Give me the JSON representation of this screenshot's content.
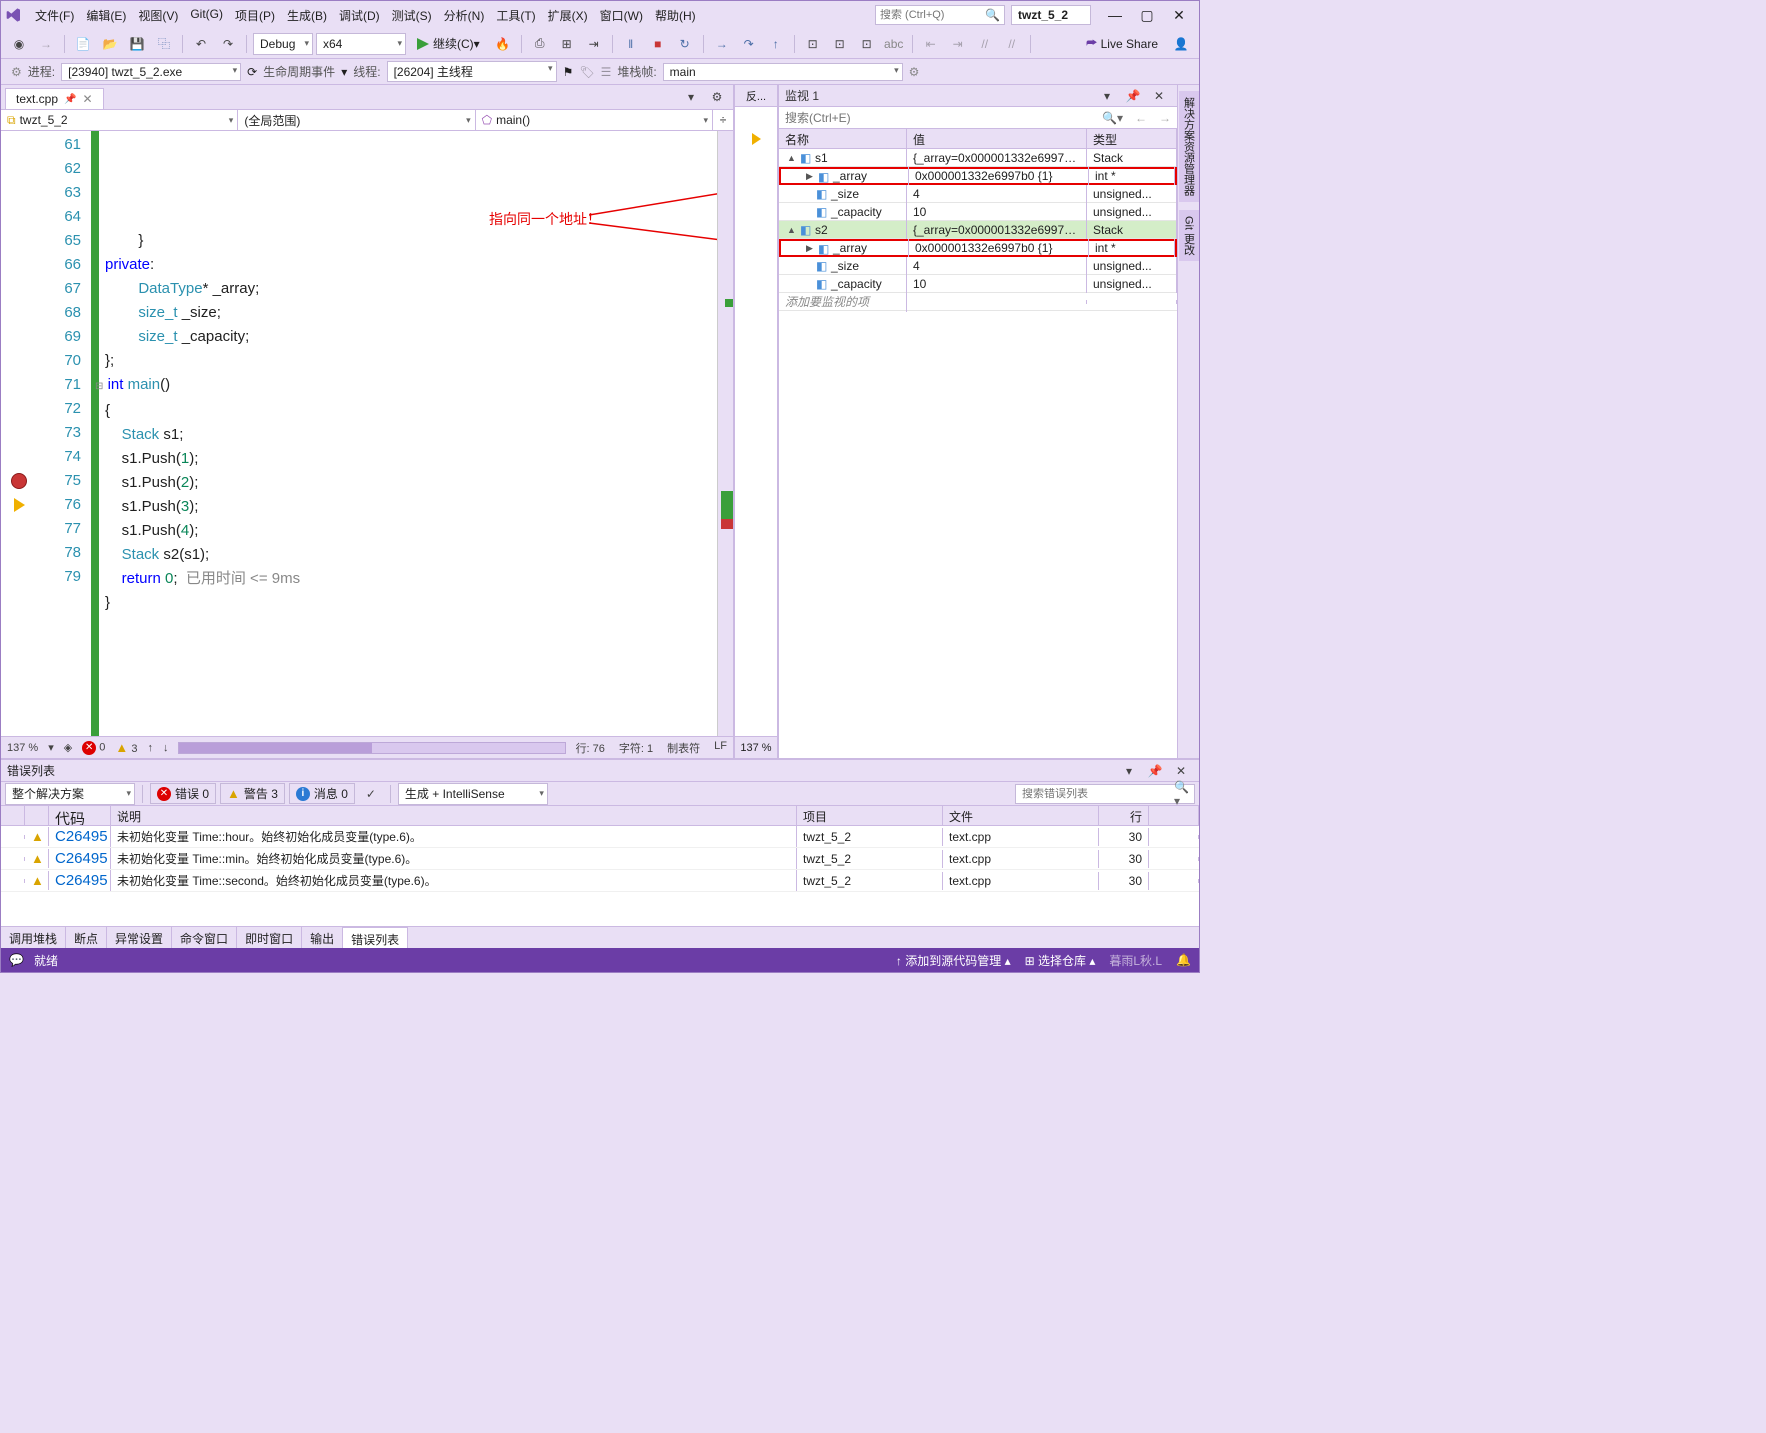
{
  "title": {
    "solution_name": "twzt_5_2",
    "search_placeholder": "搜索 (Ctrl+Q)"
  },
  "menubar": [
    "文件(F)",
    "编辑(E)",
    "视图(V)",
    "Git(G)",
    "项目(P)",
    "生成(B)",
    "调试(D)",
    "测试(S)",
    "分析(N)",
    "工具(T)",
    "扩展(X)",
    "窗口(W)",
    "帮助(H)"
  ],
  "toolbar": {
    "config": "Debug",
    "platform": "x64",
    "continue": "继续(C)",
    "liveshare": "Live Share"
  },
  "debugbar": {
    "process_lbl": "进程:",
    "process": "[23940] twzt_5_2.exe",
    "lifecycle": "生命周期事件",
    "thread_lbl": "线程:",
    "thread": "[26204] 主线程",
    "stackframe_lbl": "堆栈帧:",
    "stackframe": "main"
  },
  "editor": {
    "tab": "text.cpp",
    "nav1": "twzt_5_2",
    "nav2": "(全局范围)",
    "nav3": "main()",
    "annotation": "指向同一个地址！",
    "elapsed": "已用时间 <= 9ms",
    "zoom": "137 %",
    "err_count": "0",
    "warn_count": "3",
    "status_line": "行: 76",
    "status_col": "字符: 1",
    "status_tab": "制表符",
    "status_end": "LF",
    "mini_zoom": "137 %"
  },
  "code_lines": [
    {
      "n": 61,
      "html": "        }"
    },
    {
      "n": 62,
      "html": "<span class='kw'>private</span>:"
    },
    {
      "n": 63,
      "html": "        <span class='type'>DataType</span>* _array;"
    },
    {
      "n": 64,
      "html": "        <span class='type'>size_t</span> _size;"
    },
    {
      "n": 65,
      "html": "        <span class='type'>size_t</span> _capacity;"
    },
    {
      "n": 66,
      "html": "};"
    },
    {
      "n": 67,
      "html": ""
    },
    {
      "n": 68,
      "html": "<span class='kw'>int</span> <span class='type'>main</span>()"
    },
    {
      "n": 69,
      "html": "{"
    },
    {
      "n": 70,
      "html": "    <span class='type'>Stack</span> s1;"
    },
    {
      "n": 71,
      "html": "    s1.Push(<span class='num'>1</span>);"
    },
    {
      "n": 72,
      "html": "    s1.Push(<span class='num'>2</span>);"
    },
    {
      "n": 73,
      "html": "    s1.Push(<span class='num'>3</span>);"
    },
    {
      "n": 74,
      "html": "    s1.Push(<span class='num'>4</span>);"
    },
    {
      "n": 75,
      "html": "    <span class='type'>Stack</span> s2(s1);"
    },
    {
      "n": 76,
      "html": "    <span class='kw'>return</span> <span class='num'>0</span>;  <span class='cm'>已用时间 &lt;= 9ms</span>"
    },
    {
      "n": 77,
      "html": "}"
    },
    {
      "n": 78,
      "html": ""
    },
    {
      "n": 79,
      "html": ""
    }
  ],
  "watch": {
    "title": "监视 1",
    "search_placeholder": "搜索(Ctrl+E)",
    "headers": {
      "name": "名称",
      "value": "值",
      "type": "类型"
    },
    "rows": [
      {
        "depth": 0,
        "exp": "▲",
        "name": "s1",
        "value": "{_array=0x000001332e6997b0 {...",
        "type": "Stack",
        "sel": false
      },
      {
        "depth": 1,
        "exp": "▶",
        "name": "_array",
        "value": "0x000001332e6997b0 {1}",
        "type": "int *",
        "sel": false,
        "redbox": true
      },
      {
        "depth": 1,
        "exp": "",
        "name": "_size",
        "value": "4",
        "type": "unsigned...",
        "sel": false
      },
      {
        "depth": 1,
        "exp": "",
        "name": "_capacity",
        "value": "10",
        "type": "unsigned...",
        "sel": false
      },
      {
        "depth": 0,
        "exp": "▲",
        "name": "s2",
        "value": "{_array=0x000001332e6997b0 {...",
        "type": "Stack",
        "sel": true
      },
      {
        "depth": 1,
        "exp": "▶",
        "name": "_array",
        "value": "0x000001332e6997b0 {1}",
        "type": "int *",
        "sel": false,
        "redbox": true
      },
      {
        "depth": 1,
        "exp": "",
        "name": "_size",
        "value": "4",
        "type": "unsigned...",
        "sel": false
      },
      {
        "depth": 1,
        "exp": "",
        "name": "_capacity",
        "value": "10",
        "type": "unsigned...",
        "sel": false
      }
    ],
    "add_hint": "添加要监视的项"
  },
  "errors": {
    "title": "错误列表",
    "scope": "整个解决方案",
    "err_pill": "错误 0",
    "warn_pill": "警告 3",
    "msg_pill": "消息 0",
    "build_src": "生成 + IntelliSense",
    "search_placeholder": "搜索错误列表",
    "headers": {
      "code": "代码",
      "desc": "说明",
      "proj": "项目",
      "file": "文件",
      "line": "行"
    },
    "rows": [
      {
        "code": "C26495",
        "desc": "未初始化变量 Time::hour。始终初始化成员变量(type.6)。",
        "proj": "twzt_5_2",
        "file": "text.cpp",
        "line": "30"
      },
      {
        "code": "C26495",
        "desc": "未初始化变量 Time::min。始终初始化成员变量(type.6)。",
        "proj": "twzt_5_2",
        "file": "text.cpp",
        "line": "30"
      },
      {
        "code": "C26495",
        "desc": "未初始化变量 Time::second。始终初始化成员变量(type.6)。",
        "proj": "twzt_5_2",
        "file": "text.cpp",
        "line": "30"
      }
    ]
  },
  "bottom_tabs": [
    "调用堆栈",
    "断点",
    "异常设置",
    "命令窗口",
    "即时窗口",
    "输出",
    "错误列表"
  ],
  "statusbar": {
    "ready": "就绪",
    "src_ctrl": "添加到源代码管理",
    "repo": "选择仓库",
    "alias": "暮雨L秋.L"
  },
  "side_tabs": [
    "解决方案资源管理器",
    "Git 更改"
  ],
  "mini_label": "反..."
}
